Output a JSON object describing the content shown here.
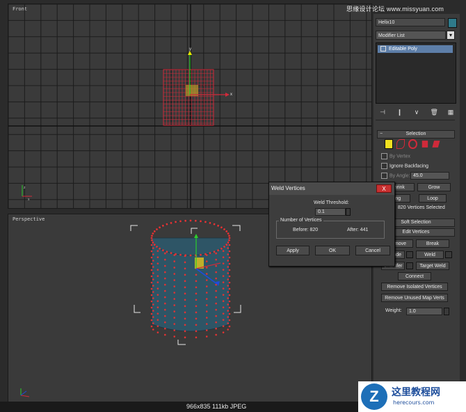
{
  "watermark": "思缘设计论坛 www.missyuan.com",
  "viewports": {
    "front_label": "Front",
    "perspective_label": "Perspective"
  },
  "panel": {
    "object_name": "Helix10",
    "object_color": "#2f7a8a",
    "modifier_list": "Modifier List",
    "stack_item": "Editable Poly",
    "selection_title": "Selection",
    "by_vertex": "By Vertex",
    "ignore_backfacing": "Ignore Backfacing",
    "by_angle": "By Angle:",
    "by_angle_value": "45.0",
    "shrink": "Shrink",
    "grow": "Grow",
    "ring": "Ring",
    "loop": "Loop",
    "selected_status": "820 Vertices Selected",
    "soft_selection": "Soft Selection",
    "edit_vertices": "Edit Vertices",
    "remove": "Remove",
    "break": "Break",
    "extrude": "Extrude",
    "weld": "Weld",
    "chamfer": "Chamfer",
    "target_weld": "Target Weld",
    "connect": "Connect",
    "remove_isolated": "Remove Isolated Vertices",
    "remove_unused": "Remove Unused Map Verts",
    "weight_label": "Weight:",
    "weight_value": "1.0"
  },
  "dialog": {
    "title": "Weld Vertices",
    "close": "X",
    "threshold_label": "Weld Threshold:",
    "threshold_value": "0.1",
    "group_label": "Number of Vertices",
    "before": "Before: 820",
    "after": "After: 441",
    "apply": "Apply",
    "ok": "OK",
    "cancel": "Cancel"
  },
  "footer": "966x835  111kb  JPEG",
  "logo": {
    "badge": "Z",
    "cn": "这里教程网",
    "url": "herecours.com"
  }
}
